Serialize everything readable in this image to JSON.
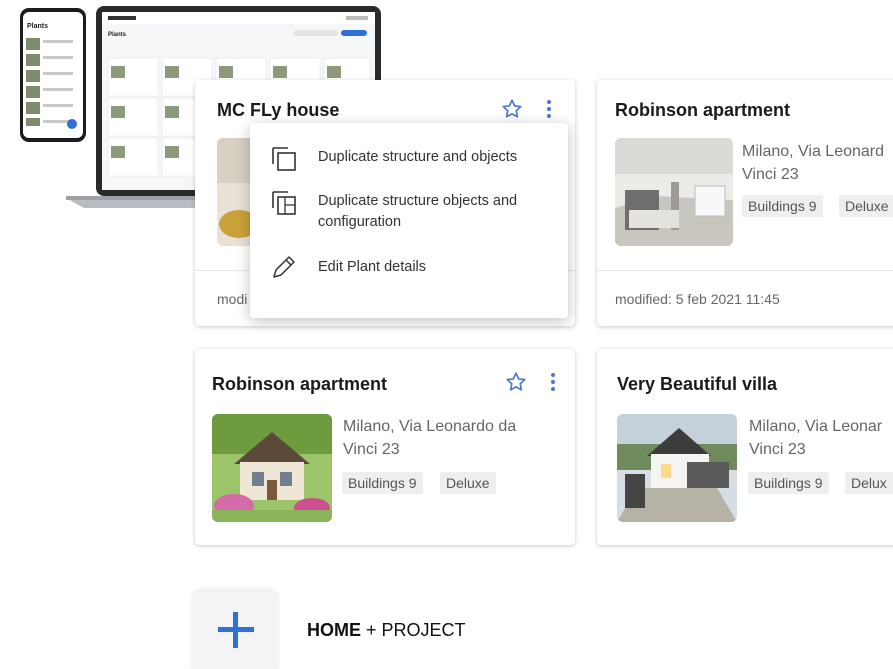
{
  "cards": [
    {
      "title": "MC FLy house",
      "footer": "modi"
    },
    {
      "title": "Robinson apartment",
      "address": "Milano, Via Leonard Vinci 23",
      "tags": [
        "Buildings 9",
        "Deluxe"
      ],
      "footer": "modified: 5 feb 2021 11:45"
    },
    {
      "title": "Robinson apartment",
      "address": "Milano, Via Leonardo da Vinci 23",
      "tags": [
        "Buildings 9",
        "Deluxe"
      ]
    },
    {
      "title": "Very Beautiful villa",
      "address": "Milano, Via Leonar Vinci 23",
      "tags": [
        "Buildings 9",
        "Delux"
      ]
    }
  ],
  "menu": {
    "items": [
      {
        "label": "Duplicate structure and objects",
        "icon": "duplicate-icon"
      },
      {
        "label": "Duplicate structure objects and configuration",
        "icon": "duplicate-config-icon"
      },
      {
        "label": "Edit Plant details",
        "icon": "pencil-icon"
      }
    ]
  },
  "brand": {
    "bold": "HOME",
    "rest": " + PROJECT"
  },
  "devices": {
    "phone_title": "Plants",
    "laptop_title": "Plants"
  },
  "colors": {
    "accent": "#2f6fd6",
    "star": "#4b77d1"
  }
}
